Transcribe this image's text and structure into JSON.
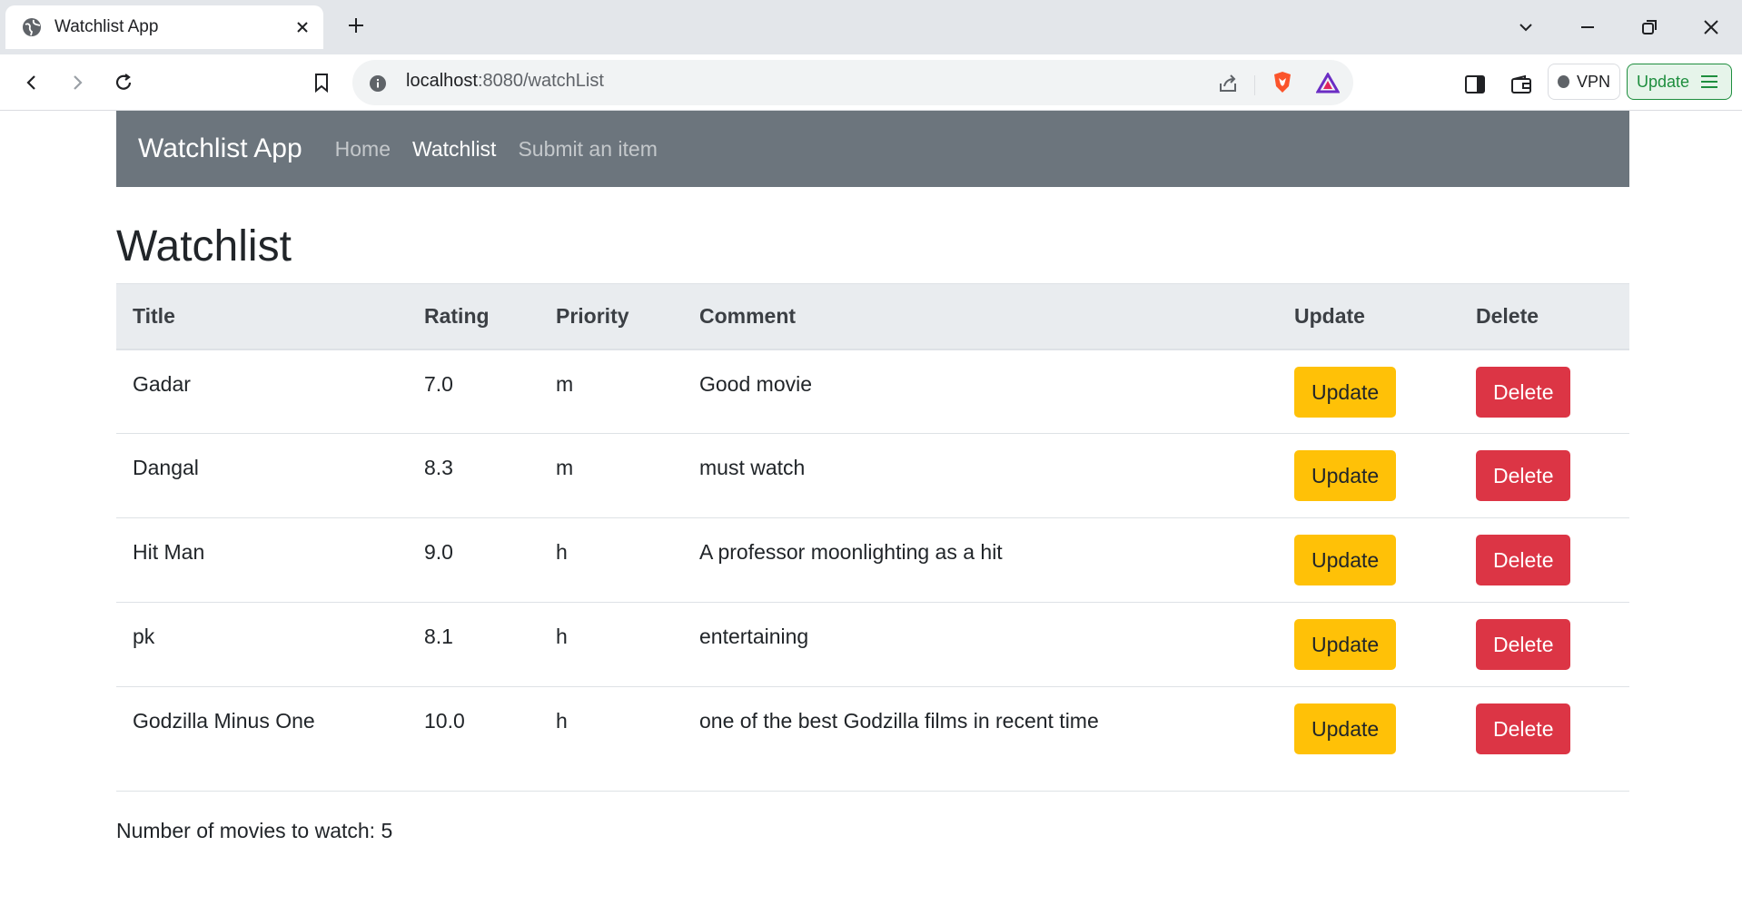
{
  "browser": {
    "tab_title": "Watchlist App",
    "url_host": "localhost",
    "url_path": ":8080/watchList",
    "vpn_label": "VPN",
    "update_label": "Update"
  },
  "navbar": {
    "brand": "Watchlist App",
    "links": [
      "Home",
      "Watchlist",
      "Submit an item"
    ],
    "active": "Watchlist"
  },
  "page": {
    "title": "Watchlist",
    "columns": [
      "Title",
      "Rating",
      "Priority",
      "Comment",
      "Update",
      "Delete"
    ],
    "rows": [
      {
        "title": "Gadar",
        "rating": "7.0",
        "priority": "m",
        "comment": "Good movie"
      },
      {
        "title": "Dangal",
        "rating": "8.3",
        "priority": "m",
        "comment": "must watch"
      },
      {
        "title": "Hit Man",
        "rating": "9.0",
        "priority": "h",
        "comment": "A professor moonlighting as a hit"
      },
      {
        "title": "pk",
        "rating": "8.1",
        "priority": "h",
        "comment": "entertaining"
      },
      {
        "title": "Godzilla Minus One",
        "rating": "10.0",
        "priority": "h",
        "comment": "one of the best Godzilla films in recent time"
      }
    ],
    "update_label": "Update",
    "delete_label": "Delete",
    "count_text": "Number of movies to watch: 5"
  },
  "colors": {
    "navbar_bg": "#6c757d",
    "update_button": "#ffc107",
    "delete_button": "#dc3545"
  }
}
